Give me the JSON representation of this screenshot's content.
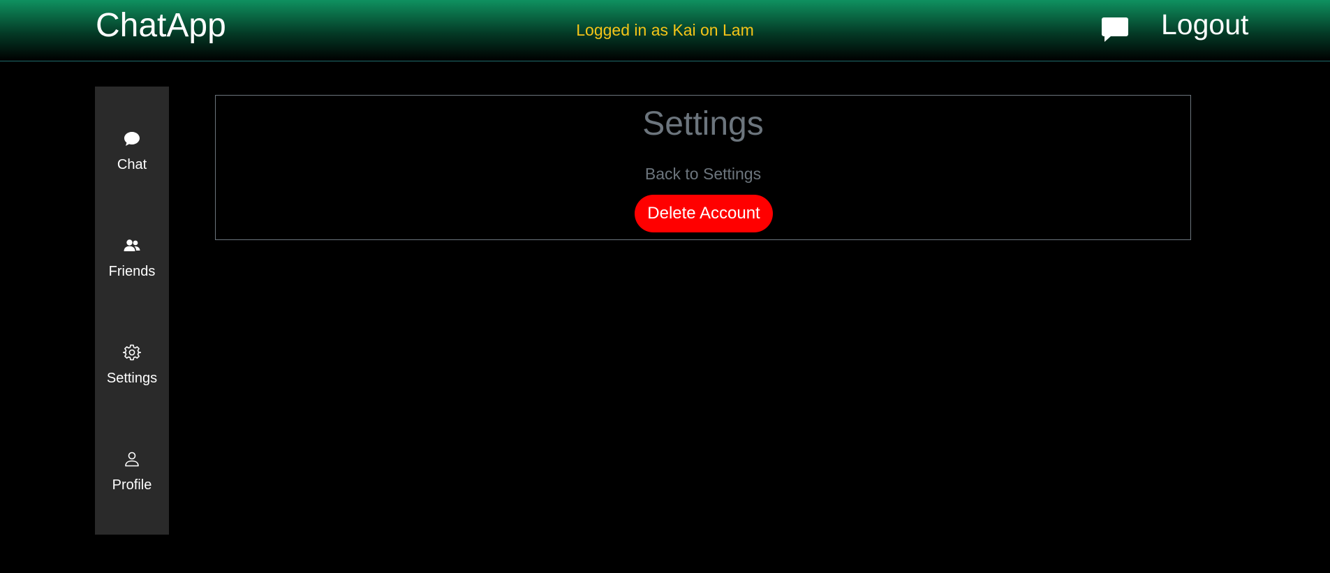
{
  "header": {
    "brand": "ChatApp",
    "status_text": "Logged in as Kai on Lam",
    "messages_icon": "message-bubble-icon",
    "logout_label": "Logout"
  },
  "sidebar": {
    "items": [
      {
        "label": "Chat",
        "icon": "chat-bubble-icon"
      },
      {
        "label": "Friends",
        "icon": "people-icon"
      },
      {
        "label": "Settings",
        "icon": "gear-icon"
      },
      {
        "label": "Profile",
        "icon": "person-icon"
      }
    ]
  },
  "main": {
    "title": "Settings",
    "back_link": "Back to Settings",
    "delete_button": "Delete Account"
  },
  "colors": {
    "status": "#f5c518",
    "delete": "#ff0000",
    "muted": "#6c757d",
    "sidebar_bg": "#2a2a2a"
  }
}
